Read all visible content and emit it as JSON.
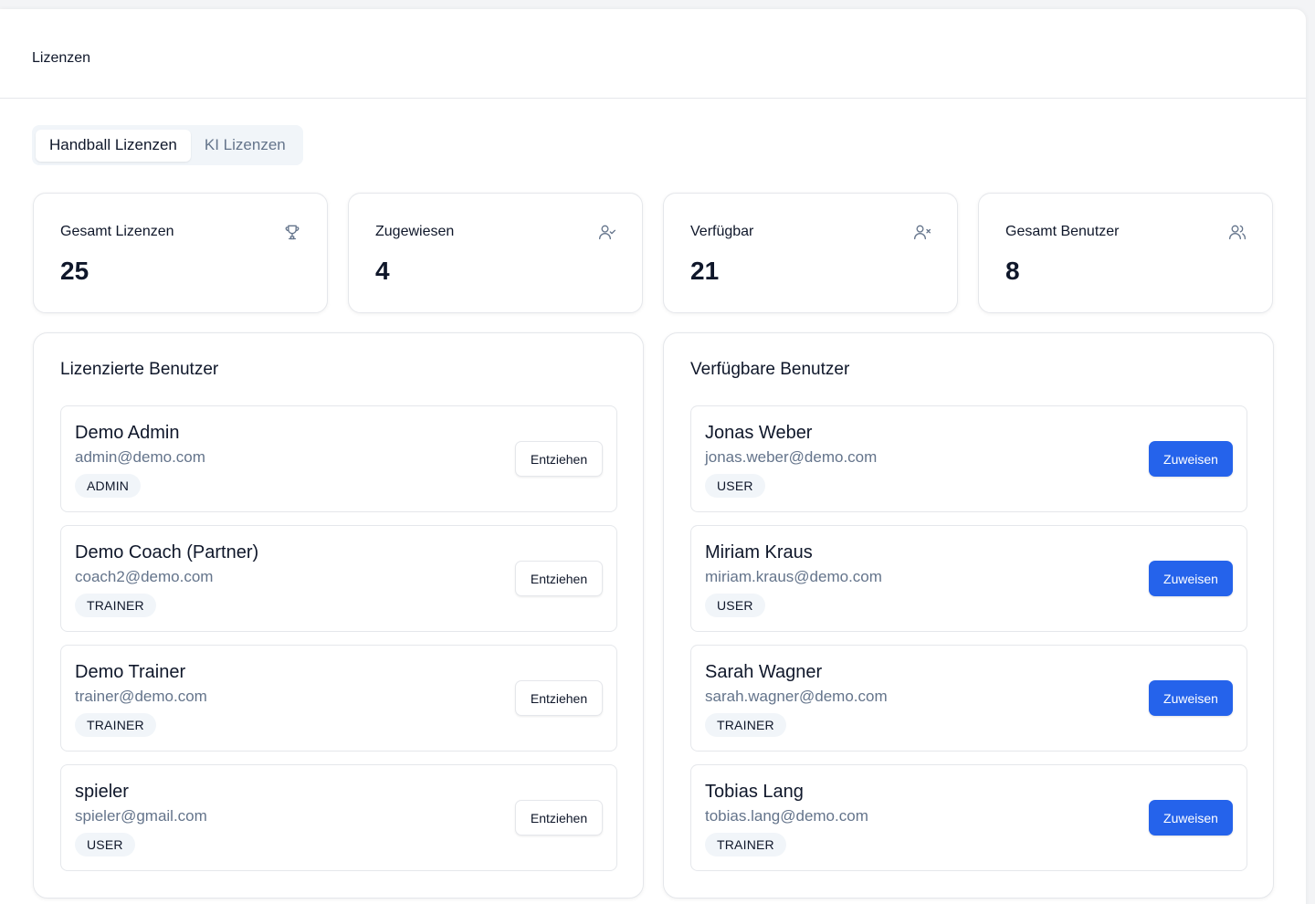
{
  "header": {
    "title": "Lizenzen"
  },
  "tabs": [
    {
      "label": "Handball Lizenzen",
      "active": true
    },
    {
      "label": "KI Lizenzen",
      "active": false
    }
  ],
  "stats": [
    {
      "label": "Gesamt Lizenzen",
      "value": "25",
      "icon": "trophy-icon"
    },
    {
      "label": "Zugewiesen",
      "value": "4",
      "icon": "user-check-icon"
    },
    {
      "label": "Verfügbar",
      "value": "21",
      "icon": "user-x-icon"
    },
    {
      "label": "Gesamt Benutzer",
      "value": "8",
      "icon": "users-icon"
    }
  ],
  "licensed": {
    "title": "Lizenzierte Benutzer",
    "action_label": "Entziehen",
    "users": [
      {
        "name": "Demo Admin",
        "email": "admin@demo.com",
        "role": "ADMIN"
      },
      {
        "name": "Demo Coach (Partner)",
        "email": "coach2@demo.com",
        "role": "TRAINER"
      },
      {
        "name": "Demo Trainer",
        "email": "trainer@demo.com",
        "role": "TRAINER"
      },
      {
        "name": "spieler",
        "email": "spieler@gmail.com",
        "role": "USER"
      }
    ]
  },
  "available": {
    "title": "Verfügbare Benutzer",
    "action_label": "Zuweisen",
    "users": [
      {
        "name": "Jonas Weber",
        "email": "jonas.weber@demo.com",
        "role": "USER"
      },
      {
        "name": "Miriam Kraus",
        "email": "miriam.kraus@demo.com",
        "role": "USER"
      },
      {
        "name": "Sarah Wagner",
        "email": "sarah.wagner@demo.com",
        "role": "TRAINER"
      },
      {
        "name": "Tobias Lang",
        "email": "tobias.lang@demo.com",
        "role": "TRAINER"
      }
    ]
  },
  "colors": {
    "accent": "#2563eb",
    "muted_text": "#64748b",
    "border": "#e5e7eb"
  }
}
